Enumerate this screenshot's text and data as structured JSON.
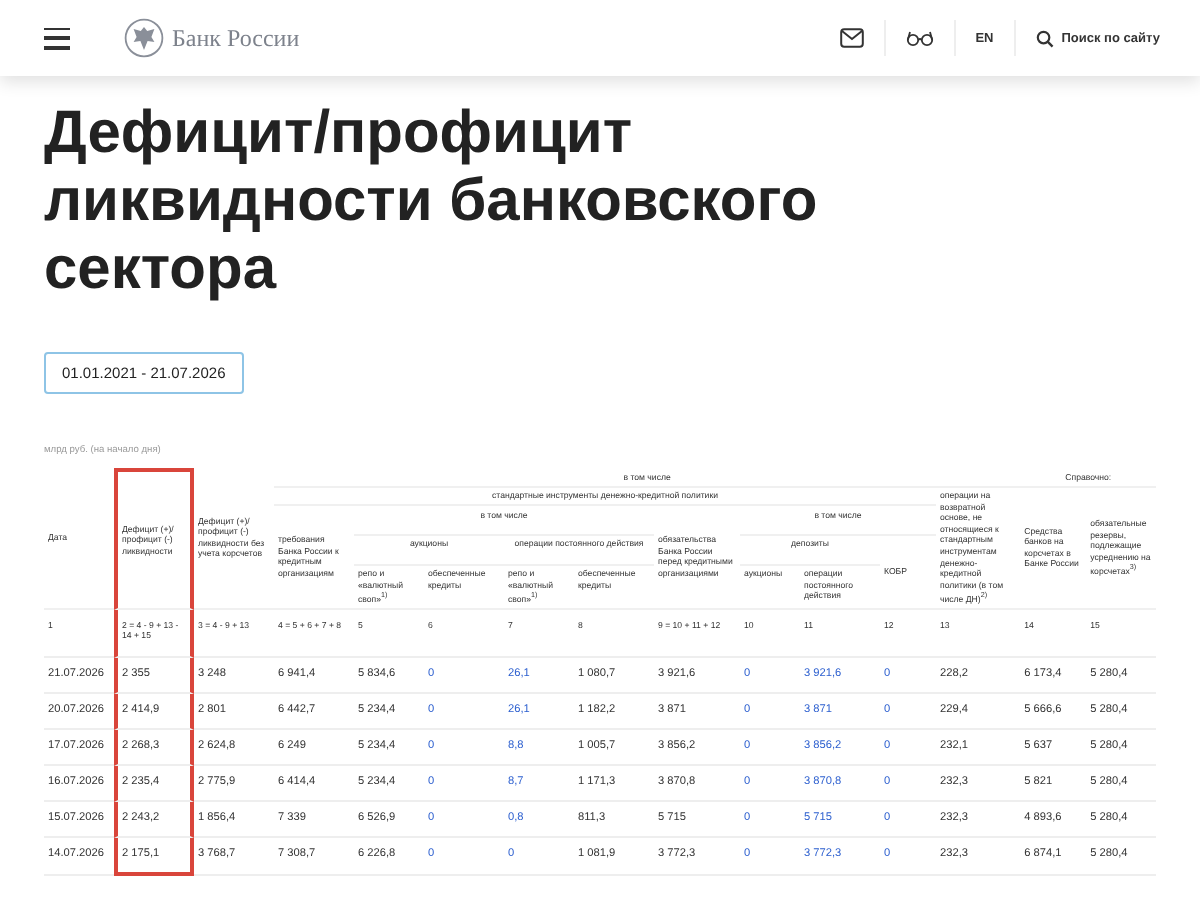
{
  "header": {
    "logo_text": "Банк России",
    "language": {
      "label": "EN",
      "selected": false
    },
    "search_label": "Поиск по сайту"
  },
  "title": "Дефицит/профицит ликвидности банковского сектора",
  "period": "01.01.2021 - 21.07.2026",
  "table": {
    "unit": "млрд руб. (на начало дня)",
    "header": {
      "date": "Дата",
      "deficit": "Дефицит (+)/ профицит (-) ликвидности",
      "deficit_no_corr": "Дефицит (+)/ профицит (-) ликвидности без учета корсчетов",
      "incl_top": "в том числе",
      "reference": "Справочно:",
      "standard": "стандартные инструменты денежно-кредитной политики",
      "claims": "требования Банка России к кредитным организациям",
      "incl_claims": "в том числе",
      "auctions": "аукционы",
      "standing": "операции постоянного действия",
      "liabilities": "обязательства Банка России перед кредитными организациями",
      "incl_liab": "в том числе",
      "deposits": "депозиты",
      "kobr": "КОБР",
      "reverse": "операции на возвратной основе, не относящиеся к стандартным инструментам денежно-кредитной политики (в том числе ДН)$^{2)}$",
      "corr": "Средства банков на корсчетах в Банке России",
      "reserves": "обязательные резервы, подлежащие усреднению на корсчетах$^{3)}$",
      "repo_a": "репо и «валютный своп»$^{1)}$",
      "loans_a": "обеспеченные кредиты",
      "repo_b": "репо и «валютный своп»$^{1)}$",
      "loans_b": "обеспеченные кредиты",
      "dep_auctions": "аукционы",
      "dep_standing": "операции постоянного действия"
    },
    "columns": [
      {
        "number": "1",
        "kind": "plain",
        "highlighted": false
      },
      {
        "number": "2 = 4 - 9 + 13 - 14 + 15",
        "kind": "plain",
        "highlighted": true
      },
      {
        "number": "3 = 4 - 9 + 13",
        "kind": "plain",
        "highlighted": false
      },
      {
        "number": "4 = 5 + 6 + 7 + 8",
        "kind": "plain",
        "highlighted": false
      },
      {
        "number": "5",
        "kind": "plain",
        "highlighted": false
      },
      {
        "number": "6",
        "kind": "link",
        "highlighted": false
      },
      {
        "number": "7",
        "kind": "link",
        "highlighted": false
      },
      {
        "number": "8",
        "kind": "plain",
        "highlighted": false
      },
      {
        "number": "9 = 10 + 11 + 12",
        "kind": "plain",
        "highlighted": false
      },
      {
        "number": "10",
        "kind": "link",
        "highlighted": false
      },
      {
        "number": "11",
        "kind": "link",
        "highlighted": false
      },
      {
        "number": "12",
        "kind": "link",
        "highlighted": false
      },
      {
        "number": "13",
        "kind": "plain",
        "highlighted": false
      },
      {
        "number": "14",
        "kind": "plain",
        "highlighted": false
      },
      {
        "number": "15",
        "kind": "plain",
        "highlighted": false
      }
    ],
    "rows": [
      [
        "21.07.2026",
        "2 355",
        "3 248",
        "6 941,4",
        "5 834,6",
        "0",
        "26,1",
        "1 080,7",
        "3 921,6",
        "0",
        "3 921,6",
        "0",
        "228,2",
        "6 173,4",
        "5 280,4"
      ],
      [
        "20.07.2026",
        "2 414,9",
        "2 801",
        "6 442,7",
        "5 234,4",
        "0",
        "26,1",
        "1 182,2",
        "3 871",
        "0",
        "3 871",
        "0",
        "229,4",
        "5 666,6",
        "5 280,4"
      ],
      [
        "17.07.2026",
        "2 268,3",
        "2 624,8",
        "6 249",
        "5 234,4",
        "0",
        "8,8",
        "1 005,7",
        "3 856,2",
        "0",
        "3 856,2",
        "0",
        "232,1",
        "5 637",
        "5 280,4"
      ],
      [
        "16.07.2026",
        "2 235,4",
        "2 775,9",
        "6 414,4",
        "5 234,4",
        "0",
        "8,7",
        "1 171,3",
        "3 870,8",
        "0",
        "3 870,8",
        "0",
        "232,3",
        "5 821",
        "5 280,4"
      ],
      [
        "15.07.2026",
        "2 243,2",
        "1 856,4",
        "7 339",
        "6 526,9",
        "0",
        "0,8",
        "811,3",
        "5 715",
        "0",
        "5 715",
        "0",
        "232,3",
        "4 893,6",
        "5 280,4"
      ],
      [
        "14.07.2026",
        "2 175,1",
        "3 768,7",
        "7 308,7",
        "6 226,8",
        "0",
        "0",
        "1 081,9",
        "3 772,3",
        "0",
        "3 772,3",
        "0",
        "232,3",
        "6 874,1",
        "5 280,4"
      ]
    ]
  }
}
